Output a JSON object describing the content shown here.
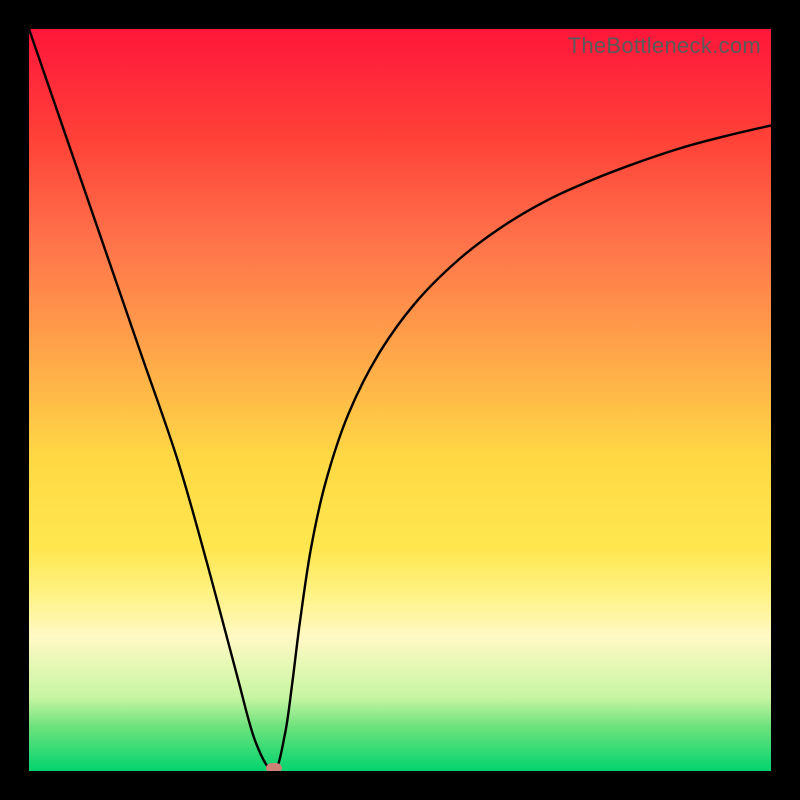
{
  "watermark": "TheBottleneck.com",
  "chart_data": {
    "type": "line",
    "title": "",
    "xlabel": "",
    "ylabel": "",
    "ylim": [
      0,
      100
    ],
    "x": [
      0.0,
      0.05,
      0.1,
      0.15,
      0.2,
      0.24,
      0.28,
      0.305,
      0.33,
      0.345,
      0.355,
      0.365,
      0.38,
      0.4,
      0.43,
      0.47,
      0.52,
      0.58,
      0.64,
      0.7,
      0.76,
      0.82,
      0.88,
      0.94,
      1.0
    ],
    "values": [
      100,
      85.5,
      71,
      56.5,
      42,
      28,
      13,
      4,
      0,
      5,
      12,
      20,
      30,
      39,
      48,
      56,
      63,
      69,
      73.5,
      77,
      79.7,
      82,
      84,
      85.6,
      87
    ],
    "min_point": {
      "x": 0.33,
      "y": 0
    },
    "gradient": {
      "top": "#ff173a",
      "mid_upper": "#ff8a3e",
      "mid": "#ffe84c",
      "mid_lower": "#f9f7b6",
      "bottom": "#03d36f"
    },
    "curve_color": "#000000",
    "marker_color": "#cd8277"
  }
}
